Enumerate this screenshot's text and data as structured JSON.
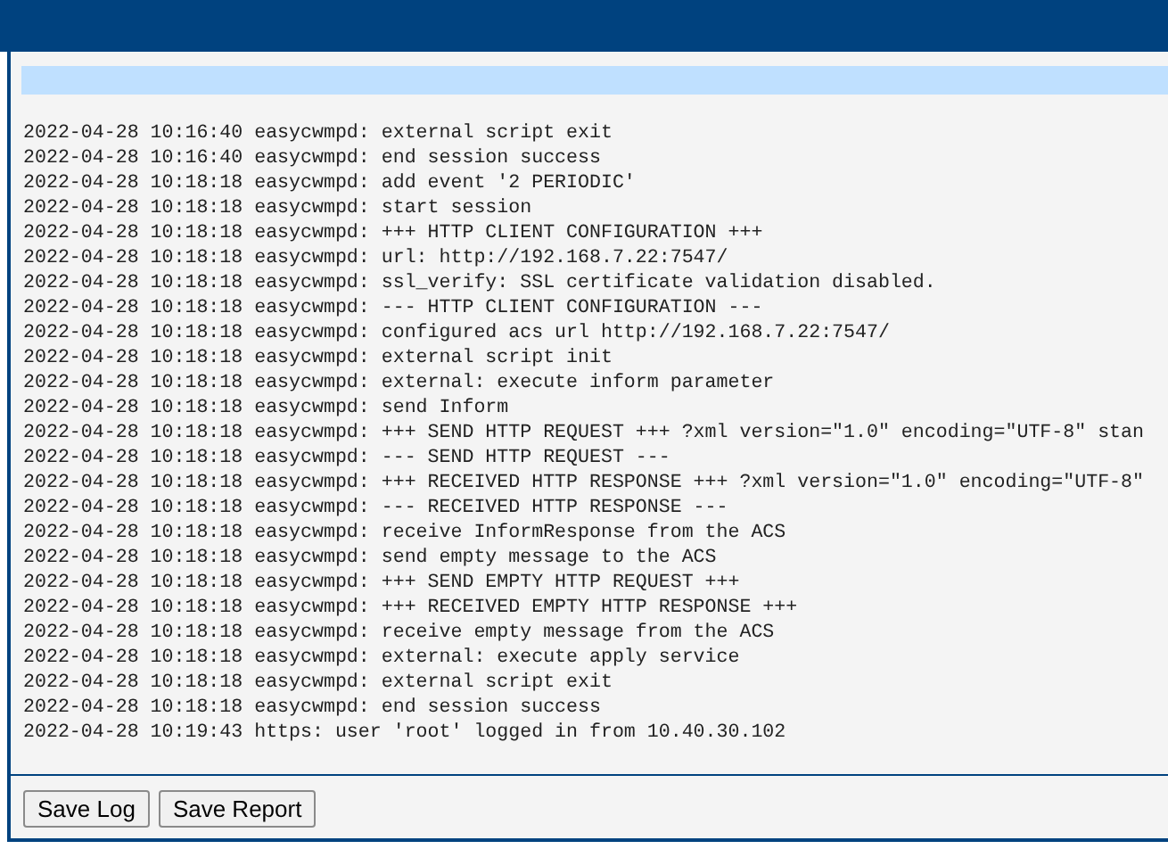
{
  "log_lines": [
    "2022-04-28 10:16:40 easycwmpd: external script exit",
    "2022-04-28 10:16:40 easycwmpd: end session success",
    "2022-04-28 10:18:18 easycwmpd: add event '2 PERIODIC'",
    "2022-04-28 10:18:18 easycwmpd: start session",
    "2022-04-28 10:18:18 easycwmpd: +++ HTTP CLIENT CONFIGURATION +++",
    "2022-04-28 10:18:18 easycwmpd: url: http://192.168.7.22:7547/",
    "2022-04-28 10:18:18 easycwmpd: ssl_verify: SSL certificate validation disabled.",
    "2022-04-28 10:18:18 easycwmpd: --- HTTP CLIENT CONFIGURATION ---",
    "2022-04-28 10:18:18 easycwmpd: configured acs url http://192.168.7.22:7547/",
    "2022-04-28 10:18:18 easycwmpd: external script init",
    "2022-04-28 10:18:18 easycwmpd: external: execute inform parameter",
    "2022-04-28 10:18:18 easycwmpd: send Inform",
    "2022-04-28 10:18:18 easycwmpd: +++ SEND HTTP REQUEST +++ ?xml version=\"1.0\" encoding=\"UTF-8\" stan",
    "2022-04-28 10:18:18 easycwmpd: --- SEND HTTP REQUEST ---",
    "2022-04-28 10:18:18 easycwmpd: +++ RECEIVED HTTP RESPONSE +++ ?xml version=\"1.0\" encoding=\"UTF-8\"",
    "2022-04-28 10:18:18 easycwmpd: --- RECEIVED HTTP RESPONSE ---",
    "2022-04-28 10:18:18 easycwmpd: receive InformResponse from the ACS",
    "2022-04-28 10:18:18 easycwmpd: send empty message to the ACS",
    "2022-04-28 10:18:18 easycwmpd: +++ SEND EMPTY HTTP REQUEST +++",
    "2022-04-28 10:18:18 easycwmpd: +++ RECEIVED EMPTY HTTP RESPONSE +++",
    "2022-04-28 10:18:18 easycwmpd: receive empty message from the ACS",
    "2022-04-28 10:18:18 easycwmpd: external: execute apply service",
    "2022-04-28 10:18:18 easycwmpd: external script exit",
    "2022-04-28 10:18:18 easycwmpd: end session success",
    "2022-04-28 10:19:43 https: user 'root' logged in from 10.40.30.102"
  ],
  "buttons": [
    "Save Log",
    "Save Report"
  ]
}
